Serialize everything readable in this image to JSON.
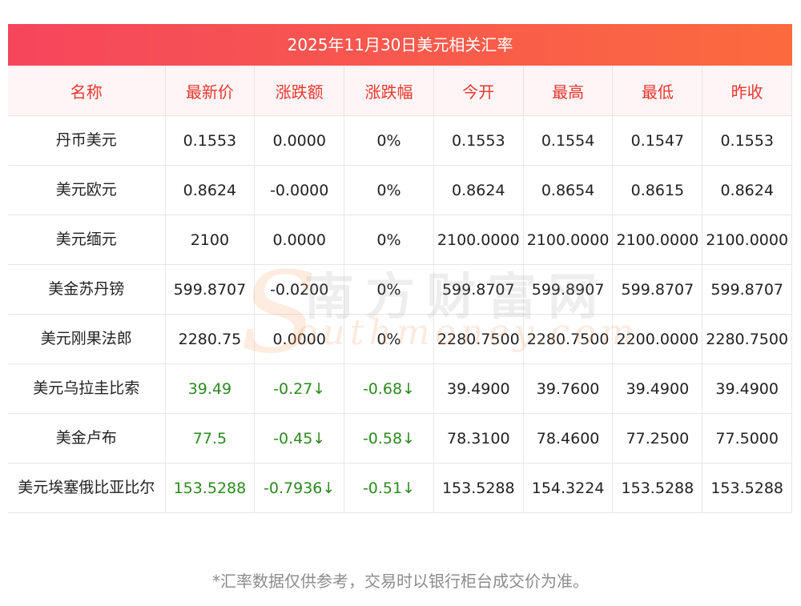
{
  "title": "2025年11月30日美元相关汇率",
  "headers": [
    "名称",
    "最新价",
    "涨跌额",
    "涨跌幅",
    "今开",
    "最高",
    "最低",
    "昨收"
  ],
  "rows": [
    {
      "cells": [
        "丹币美元",
        "0.1553",
        "0.0000",
        "0%",
        "0.1553",
        "0.1554",
        "0.1547",
        "0.1553"
      ],
      "down": false
    },
    {
      "cells": [
        "美元欧元",
        "0.8624",
        "-0.0000",
        "0%",
        "0.8624",
        "0.8654",
        "0.8615",
        "0.8624"
      ],
      "down": false
    },
    {
      "cells": [
        "美元缅元",
        "2100",
        "0.0000",
        "0%",
        "2100.0000",
        "2100.0000",
        "2100.0000",
        "2100.0000"
      ],
      "down": false
    },
    {
      "cells": [
        "美金苏丹镑",
        "599.8707",
        "-0.0200",
        "0%",
        "599.8707",
        "599.8907",
        "599.8707",
        "599.8707"
      ],
      "down": false
    },
    {
      "cells": [
        "美元刚果法郎",
        "2280.75",
        "0.0000",
        "0%",
        "2280.7500",
        "2280.7500",
        "2200.0000",
        "2280.7500"
      ],
      "down": false
    },
    {
      "cells": [
        "美元乌拉圭比索",
        "39.49",
        "-0.27↓",
        "-0.68↓",
        "39.4900",
        "39.7600",
        "39.4900",
        "39.4900"
      ],
      "down": true
    },
    {
      "cells": [
        "美金卢布",
        "77.5",
        "-0.45↓",
        "-0.58↓",
        "78.3100",
        "78.4600",
        "77.2500",
        "77.5000"
      ],
      "down": true
    },
    {
      "cells": [
        "美元埃塞俄比亚比尔",
        "153.5288",
        "-0.7936↓",
        "-0.51↓",
        "153.5288",
        "154.3224",
        "153.5288",
        "153.5288"
      ],
      "down": true
    }
  ],
  "watermark": {
    "cn": "南方财富网",
    "en": "outhmoney.com",
    "s": "S"
  },
  "footnote": "*汇率数据仅供参考，交易时以银行柜台成交价为准。",
  "colors": {
    "banner_start": "#f5465c",
    "banner_end": "#fb6b3e",
    "header_text": "#e8372e",
    "down": "#2b8a1e"
  }
}
